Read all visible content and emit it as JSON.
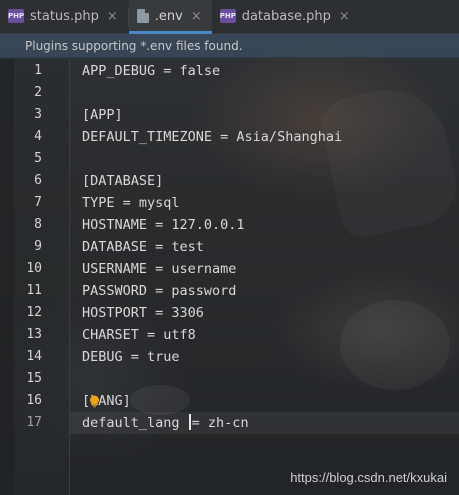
{
  "tabs": [
    {
      "label": "status.php",
      "icon": "php-file-icon",
      "active": false
    },
    {
      "label": ".env",
      "icon": "env-file-icon",
      "active": true
    },
    {
      "label": "database.php",
      "icon": "php-file-icon",
      "active": false
    }
  ],
  "php_icon_text": "PHP",
  "close_glyph": "×",
  "banner": {
    "text": "Plugins supporting *.env files found."
  },
  "editor": {
    "line_numbers": [
      "1",
      "2",
      "3",
      "4",
      "5",
      "6",
      "7",
      "8",
      "9",
      "10",
      "11",
      "12",
      "13",
      "14",
      "15",
      "16",
      "17"
    ],
    "lines": [
      "APP_DEBUG = false",
      "",
      "[APP]",
      "DEFAULT_TIMEZONE = Asia/Shanghai",
      "",
      "[DATABASE]",
      "TYPE = mysql",
      "HOSTNAME = 127.0.0.1",
      "DATABASE = test",
      "USERNAME = username",
      "PASSWORD = password",
      "HOSTPORT = 3306",
      "CHARSET = utf8",
      "DEBUG = true",
      "",
      "[LANG]",
      "default_lang = zh-cn"
    ],
    "line17_before_caret": "default_lang ",
    "line17_after_caret": "= zh-cn",
    "current_line": 17
  },
  "watermark": "https://blog.csdn.net/kxukai",
  "colors": {
    "accent_tab": "#4a88c7",
    "banner_bg": "#3a485a",
    "php_icon": "#6a4f9e",
    "bulb": "#f0a30a"
  }
}
